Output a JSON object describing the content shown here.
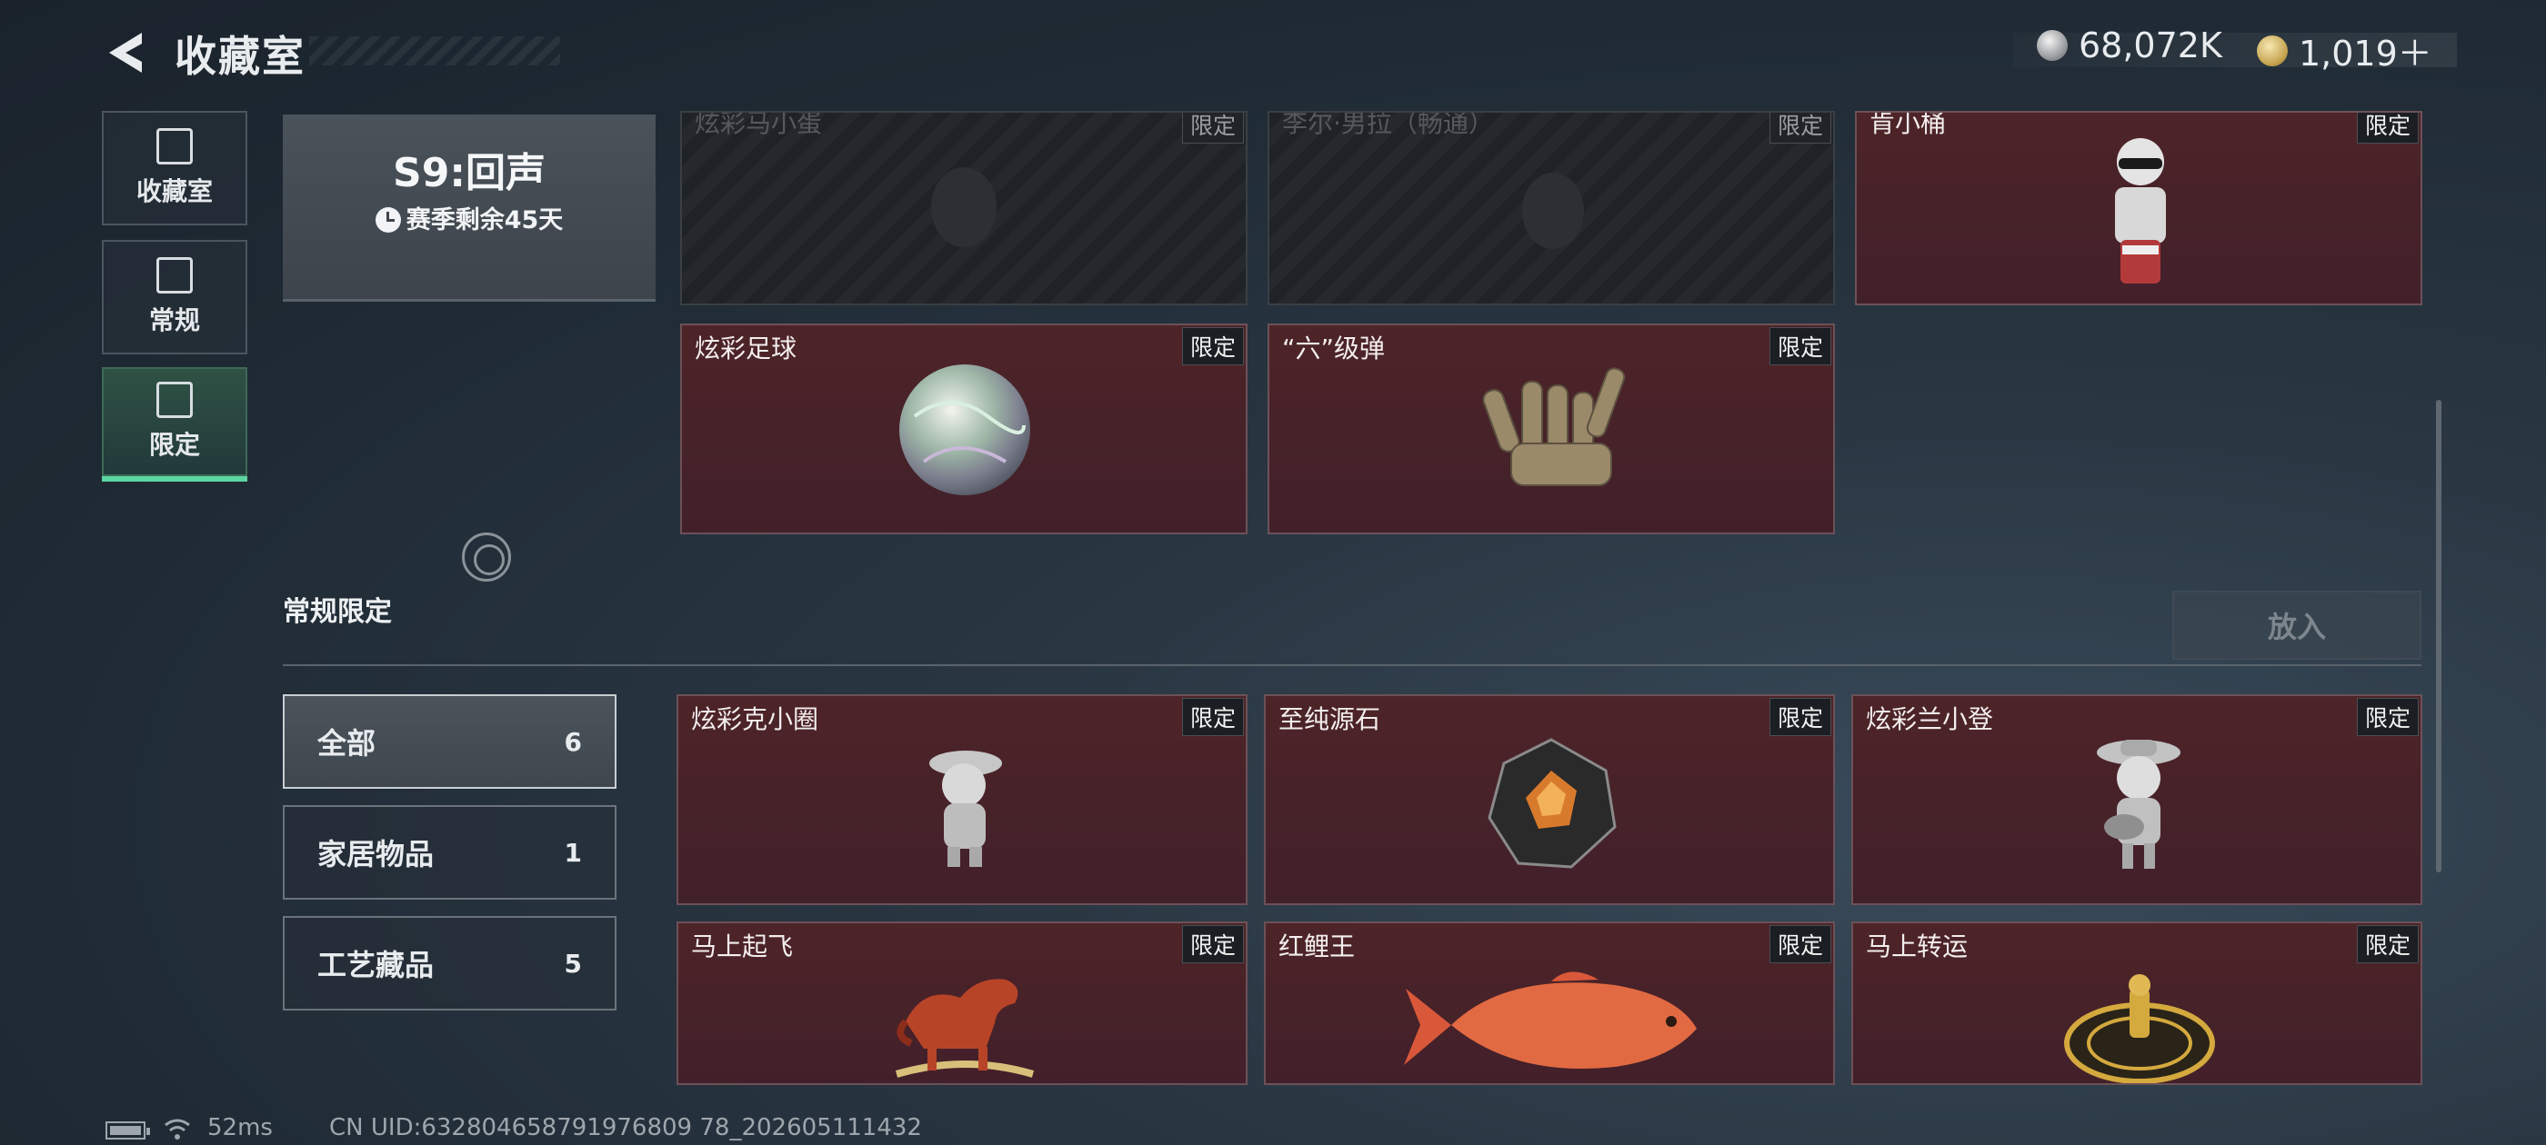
{
  "header": {
    "title": "收藏室",
    "currencies": [
      {
        "icon": "silver-coin-icon",
        "value": "68,072K"
      },
      {
        "icon": "gold-coin-icon",
        "value": "1,019＋"
      }
    ]
  },
  "nav": [
    {
      "label": "收藏室",
      "icon": "collection-room-icon",
      "active": false
    },
    {
      "label": "常规",
      "icon": "regular-icon",
      "active": false
    },
    {
      "label": "限定",
      "icon": "limited-icon",
      "active": true
    }
  ],
  "season": {
    "title": "S9:回声",
    "remaining": "赛季剩余45天"
  },
  "top_cards": [
    {
      "name": "炫彩马小蛋",
      "tag": "限定",
      "dim": true
    },
    {
      "name": "李尔·男拉（畅通）",
      "tag": "限定",
      "dim": true
    },
    {
      "name": "肯小桶",
      "tag": "限定",
      "dim": false
    },
    {
      "name": "炫彩足球",
      "tag": "限定",
      "dim": false
    },
    {
      "name": "“六”级弹",
      "tag": "限定",
      "dim": false
    }
  ],
  "section": {
    "title": "常规限定",
    "place_button": "放入"
  },
  "filters": [
    {
      "label": "全部",
      "count": "6",
      "active": true
    },
    {
      "label": "家居物品",
      "count": "1",
      "active": false
    },
    {
      "label": "工艺藏品",
      "count": "5",
      "active": false
    }
  ],
  "items": [
    {
      "name": "炫彩克小圈",
      "tag": "限定"
    },
    {
      "name": "至纯源石",
      "tag": "限定"
    },
    {
      "name": "炫彩兰小登",
      "tag": "限定"
    },
    {
      "name": "马上起飞",
      "tag": "限定"
    },
    {
      "name": "红鲤王",
      "tag": "限定"
    },
    {
      "name": "马上转运",
      "tag": "限定"
    }
  ],
  "status": {
    "ping": "52ms",
    "uid": "CN UID:632804658791976809 78_202605111432"
  }
}
